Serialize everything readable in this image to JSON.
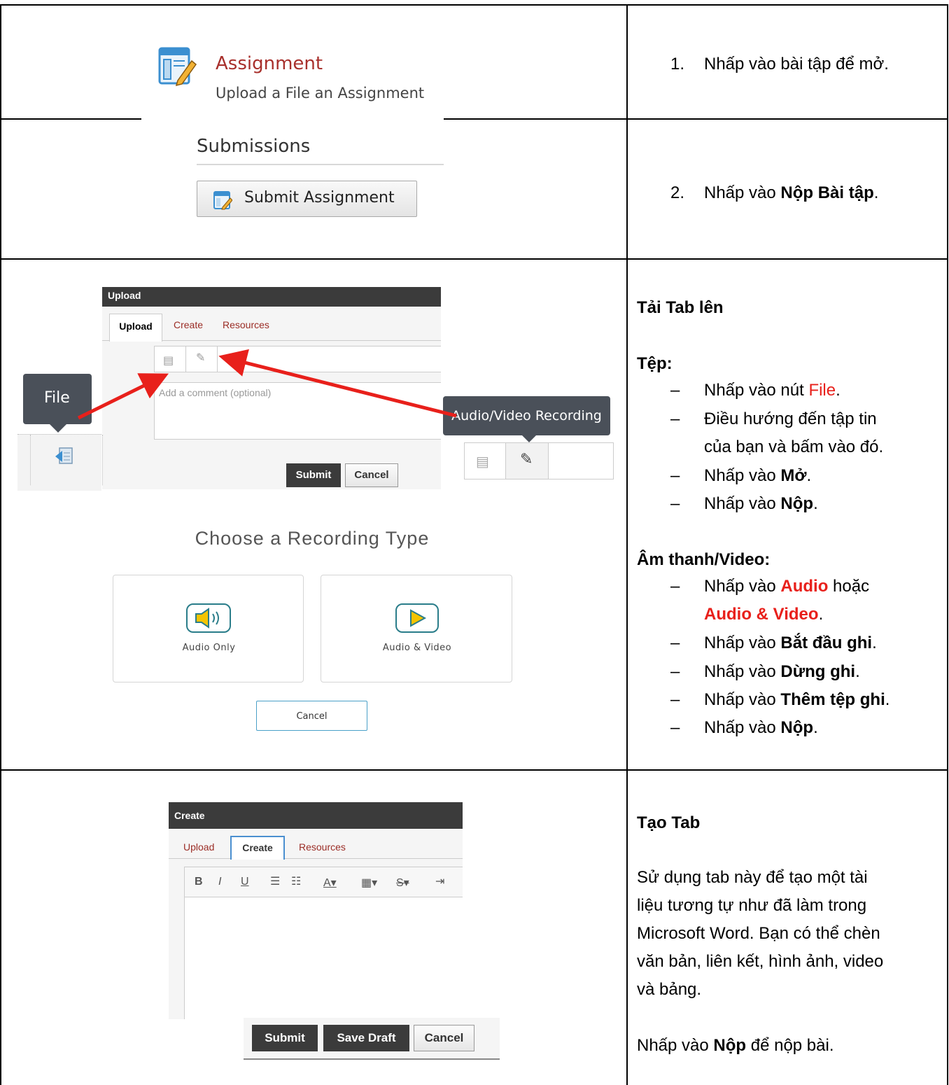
{
  "row1": {
    "assignment_title": "Assignment",
    "assignment_subtitle": "Upload a File an Assignment",
    "step_number": "1.",
    "step_text": "Nhấp vào bài tập để mở."
  },
  "row2": {
    "submissions_heading": "Submissions",
    "submit_button": "Submit Assignment",
    "step_number": "2.",
    "step_pre": "Nhấp vào ",
    "step_bold": "Nộp Bài tập",
    "step_post": "."
  },
  "row3": {
    "panel_title": "Upload",
    "tabs": {
      "upload": "Upload",
      "create": "Create",
      "resources": "Resources"
    },
    "comment_placeholder": "Add a comment (optional)",
    "file_tooltip": "File",
    "av_tooltip": "Audio/Video Recording",
    "submit_label": "Submit",
    "cancel_label": "Cancel",
    "recording_heading": "Choose a Recording Type",
    "audio_only": "Audio Only",
    "audio_video": "Audio & Video",
    "recording_cancel": "Cancel",
    "heading": "Tải Tab lên",
    "file_heading": "Tệp:",
    "file_steps": {
      "s1_pre": "Nhấp vào nút ",
      "s1_red": "File",
      "s1_post": ".",
      "s2_line1": "Điều hướng đến tập tin",
      "s2_line2": "của bạn và bấm vào đó.",
      "s3_pre": "Nhấp vào ",
      "s3_bold": "Mở",
      "s3_post": ".",
      "s4_pre": "Nhấp vào ",
      "s4_bold": "Nộp",
      "s4_post": "."
    },
    "av_heading": "Âm thanh/Video:",
    "av_steps": {
      "s1_pre": "Nhấp vào ",
      "s1_red": "Audio",
      "s1_mid": " hoặc",
      "s1_red2": "Audio & Video",
      "s1_post": ".",
      "s2_pre": "Nhấp vào ",
      "s2_bold": "Bắt đầu ghi",
      "s2_post": ".",
      "s3_pre": "Nhấp vào ",
      "s3_bold": "Dừng ghi",
      "s3_post": ".",
      "s4_pre": "Nhấp vào ",
      "s4_bold": "Thêm tệp ghi",
      "s4_post": ".",
      "s5_pre": "Nhấp vào ",
      "s5_bold": "Nộp",
      "s5_post": "."
    },
    "dash": "–"
  },
  "row4": {
    "panel_title": "Create",
    "tabs": {
      "upload": "Upload",
      "create": "Create",
      "resources": "Resources"
    },
    "toolbar": {
      "bold": "B",
      "italic": "I",
      "underline": "U"
    },
    "submit_label": "Submit",
    "save_draft_label": "Save Draft",
    "cancel_label": "Cancel",
    "heading": "Tạo Tab",
    "paragraph_lines": [
      "Sử dụng tab này để tạo một tài",
      "liệu tương tự như đã làm trong",
      "Microsoft Word. Bạn có thể chèn",
      "văn bản, liên kết, hình ảnh, video",
      "và bảng."
    ],
    "final_pre": "Nhấp vào ",
    "final_bold": "Nộp",
    "final_post": " để nộp bài."
  },
  "colors": {
    "red_text": "#e8201b",
    "arrow": "#e8201b",
    "dark_bar": "#3b3b3b",
    "teal": "#2a7d8a"
  }
}
